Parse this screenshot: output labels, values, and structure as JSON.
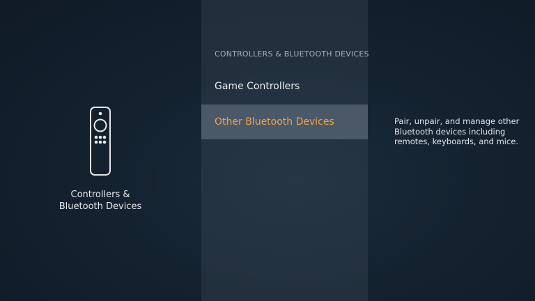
{
  "category": {
    "icon": "fire-tv-remote-icon",
    "label_line1": "Controllers &",
    "label_line2": "Bluetooth Devices"
  },
  "menu": {
    "header": "CONTROLLERS & BLUETOOTH DEVICES",
    "items": [
      {
        "label": "Game Controllers",
        "selected": false
      },
      {
        "label": "Other Bluetooth Devices",
        "selected": true
      }
    ]
  },
  "detail": {
    "description": "Pair, unpair, and manage other Bluetooth devices including remotes, keyboards, and mice."
  },
  "colors": {
    "accent": "#f3a33c",
    "background": "#142230",
    "text": "#e8ebee"
  }
}
